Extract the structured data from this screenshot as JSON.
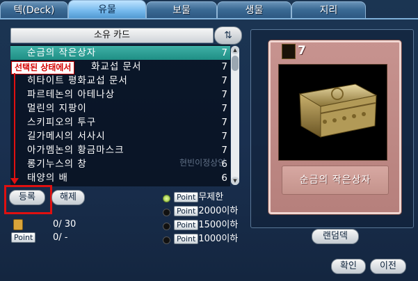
{
  "tabs": [
    "텍(Deck)",
    "유물",
    "보물",
    "생물",
    "지리"
  ],
  "active_tab": "유물",
  "list_header": "소유 카드",
  "sort_icon": "swap-arrows-icon",
  "cards": [
    {
      "name": "순금의 작은상자",
      "count": "7"
    },
    {
      "name": "화교섭 문서",
      "count": "7"
    },
    {
      "name": "히타이트 평화교섭 문서",
      "count": "7"
    },
    {
      "name": "파르테논의 아테나상",
      "count": "7"
    },
    {
      "name": "멀린의 지팡이",
      "count": "7"
    },
    {
      "name": "스키피오의 투구",
      "count": "7"
    },
    {
      "name": "길가메시의 서사시",
      "count": "7"
    },
    {
      "name": "아가멤논의 황금마스크",
      "count": "7"
    },
    {
      "name": "롱기누스의 창",
      "count": "6"
    },
    {
      "name": "태양의 배",
      "count": "6"
    }
  ],
  "selected_index": 0,
  "annotation": "선택된 상태에서",
  "buttons": {
    "register": "등록",
    "release": "해제",
    "random": "랜덤덱",
    "confirm": "확인",
    "back": "이전"
  },
  "stats": {
    "card_count": "0/  30",
    "point_label": "Point",
    "point_value": "0/   -"
  },
  "filters": [
    {
      "tag": "Point",
      "label": "무제한",
      "active": true
    },
    {
      "tag": "Point",
      "label": "2000이하",
      "active": false
    },
    {
      "tag": "Point",
      "label": "1500이하",
      "active": false
    },
    {
      "tag": "Point",
      "label": "1000이하",
      "active": false
    }
  ],
  "watermark": "현빈이정상인",
  "card": {
    "value": "7",
    "name": "순금의 작은상자",
    "icon": "pharaoh-mask-icon",
    "art": "golden-chest-image"
  },
  "colors": {
    "selected_row": "#2aa89c",
    "annotation_red": "#e01010",
    "card_bg": "#c08a86"
  }
}
